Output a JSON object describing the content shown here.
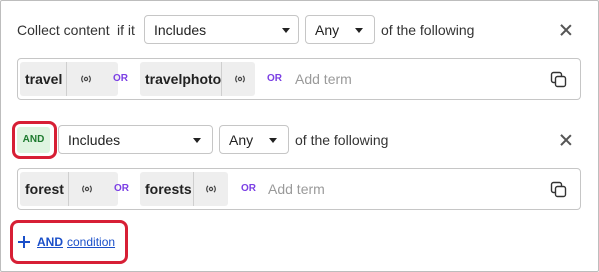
{
  "row1": {
    "label_a": "Collect content",
    "label_b": "if it",
    "select_match": "Includes",
    "select_quant": "Any",
    "suffix": "of the following"
  },
  "terms1": {
    "chips": [
      "travel",
      "travelphoto"
    ],
    "or_label": "OR",
    "or_label_2": "OR",
    "placeholder": "Add term"
  },
  "row2": {
    "operator": "AND",
    "select_match": "Includes",
    "select_quant": "Any",
    "suffix": "of the following"
  },
  "terms2": {
    "chips": [
      "forest",
      "forests"
    ],
    "or_label": "OR",
    "or_label_2": "OR",
    "placeholder": "Add term"
  },
  "add_condition": {
    "bold": "AND",
    "rest": "condition"
  },
  "colors": {
    "or_purple": "#7b3fe4",
    "and_green": "#1c7a2e",
    "link_blue": "#1a4fc9",
    "highlight_red": "#d71f35"
  },
  "icons": [
    "broadcast-icon",
    "copy-icon",
    "close-icon",
    "plus-icon",
    "caret-down-icon"
  ]
}
